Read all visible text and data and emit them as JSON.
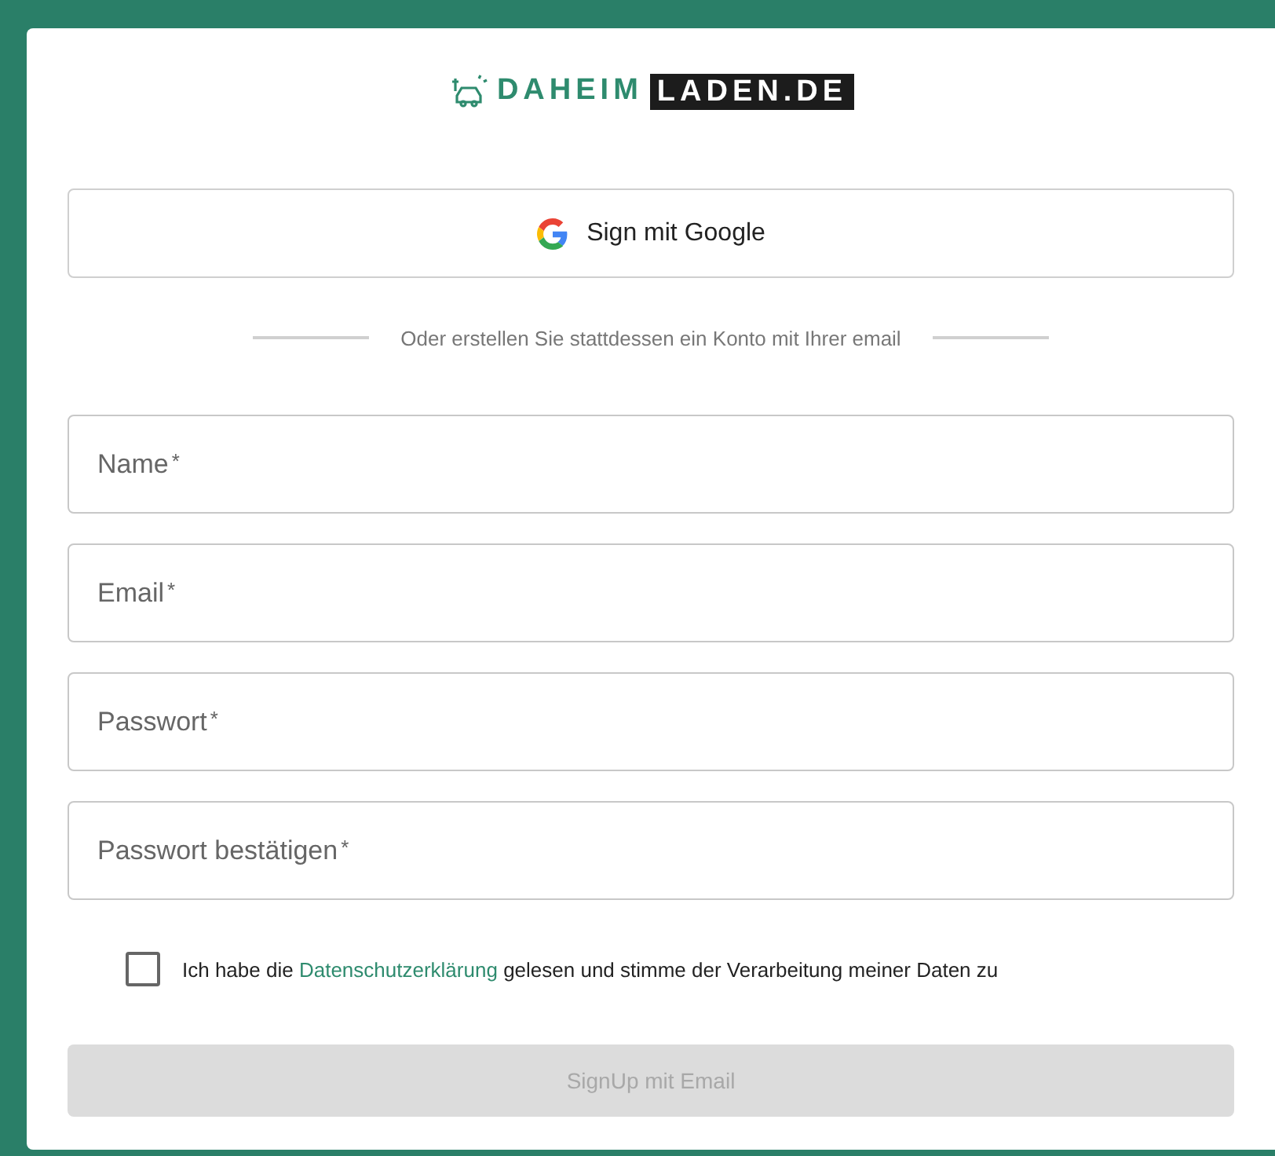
{
  "logo": {
    "part_1": "DAHEIM",
    "part_2": "LADEN.DE"
  },
  "google_button": {
    "label": "Sign mit Google"
  },
  "divider_text": "Oder erstellen Sie stattdessen ein Konto mit Ihrer email",
  "fields": [
    {
      "placeholder": "Name",
      "required_mark": "*"
    },
    {
      "placeholder": "Email",
      "required_mark": "*"
    },
    {
      "placeholder": "Passwort",
      "required_mark": "*"
    },
    {
      "placeholder": "Passwort bestätigen",
      "required_mark": "*"
    }
  ],
  "consent": {
    "checked": false,
    "text_before": "Ich habe die",
    "link": "Datenschutzerklärung",
    "text_after": "gelesen und stimme der Verarbeitung meiner Daten zu"
  },
  "submit_button": {
    "label": "SignUp mit Email",
    "disabled": true
  }
}
